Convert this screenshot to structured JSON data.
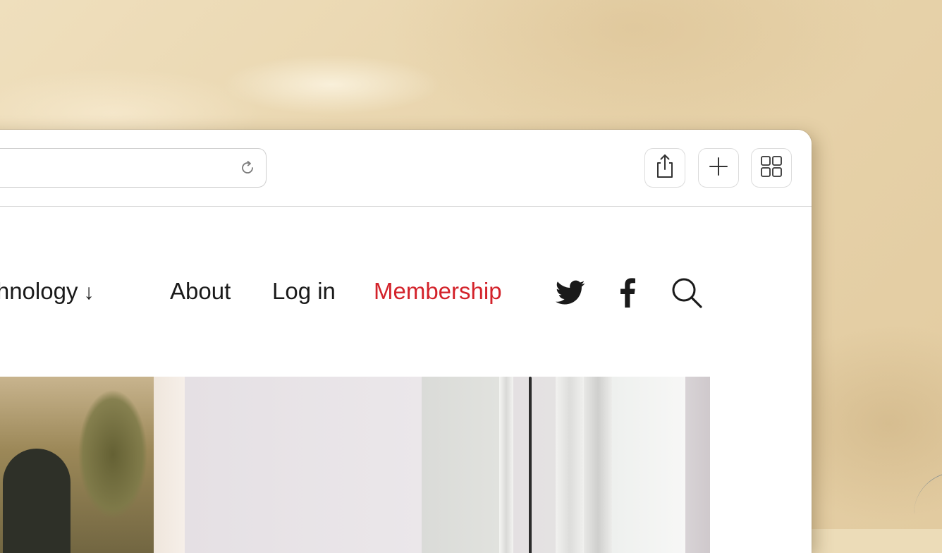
{
  "browser": {
    "icons": {
      "reload": "reload-icon",
      "share": "share-icon",
      "new_tab": "plus-icon",
      "tab_overview": "grid-icon"
    }
  },
  "nav": {
    "items": [
      {
        "label": "Technology",
        "visible_label": "echnology",
        "has_dropdown": true,
        "arrow": "↓"
      },
      {
        "label": "About"
      },
      {
        "label": "Log in"
      },
      {
        "label": "Membership",
        "highlight": true
      }
    ],
    "social_icons": [
      "twitter-icon",
      "facebook-icon"
    ],
    "search_icon": "search-icon"
  },
  "colors": {
    "accent": "#d3222a",
    "text": "#1a1a1a",
    "background_paper": "#ecdcb8"
  }
}
